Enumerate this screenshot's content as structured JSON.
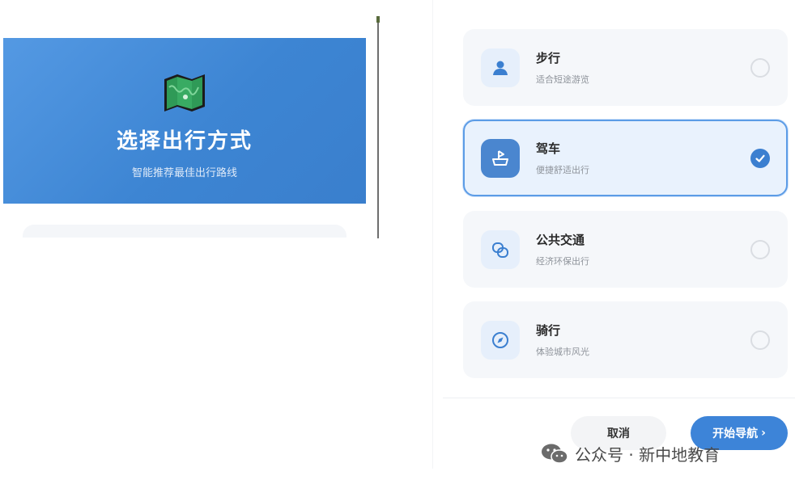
{
  "hero": {
    "title": "选择出行方式",
    "subtitle": "智能推荐最佳出行路线",
    "icon": "map-icon"
  },
  "options": [
    {
      "id": "walk",
      "title": "步行",
      "desc": "适合短途游览",
      "icon": "person-icon",
      "selected": false
    },
    {
      "id": "drive",
      "title": "驾车",
      "desc": "便捷舒适出行",
      "icon": "car-icon",
      "selected": true
    },
    {
      "id": "transit",
      "title": "公共交通",
      "desc": "经济环保出行",
      "icon": "transit-icon",
      "selected": false
    },
    {
      "id": "bike",
      "title": "骑行",
      "desc": "体验城市风光",
      "icon": "compass-icon",
      "selected": false
    }
  ],
  "footer": {
    "cancel_label": "取消",
    "start_label": "开始导航",
    "start_arrow": "›"
  },
  "watermark": {
    "text": "公众号 · 新中地教育",
    "icon": "wechat-icon"
  },
  "colors": {
    "accent": "#3d84d8",
    "hero_bg": "#4a8ed8",
    "selected_border": "#5c9ce6",
    "selected_bg": "#e9f2fd",
    "card_bg": "#f5f7fa"
  }
}
